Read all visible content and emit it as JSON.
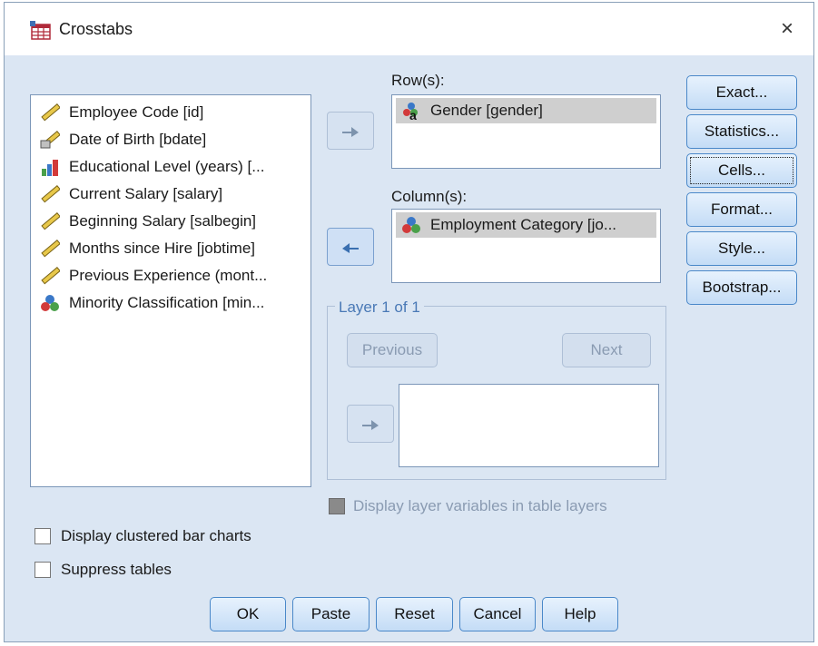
{
  "window": {
    "title": "Crosstabs",
    "close_label": "×"
  },
  "source_variables": [
    {
      "label": "Employee Code [id]",
      "icon": "scale-ruler-icon"
    },
    {
      "label": "Date of Birth [bdate]",
      "icon": "date-ruler-icon"
    },
    {
      "label": "Educational Level (years) [...",
      "icon": "ordinal-bars-icon"
    },
    {
      "label": "Current Salary [salary]",
      "icon": "scale-ruler-icon"
    },
    {
      "label": "Beginning Salary [salbegin]",
      "icon": "scale-ruler-icon"
    },
    {
      "label": "Months since Hire [jobtime]",
      "icon": "scale-ruler-icon"
    },
    {
      "label": "Previous Experience (mont...",
      "icon": "scale-ruler-icon"
    },
    {
      "label": "Minority Classification [min...",
      "icon": "nominal-balls-icon"
    }
  ],
  "rows": {
    "label": "Row(s):",
    "items": [
      {
        "label": "Gender [gender]",
        "icon": "nominal-string-icon"
      }
    ]
  },
  "columns": {
    "label": "Column(s):",
    "items": [
      {
        "label": "Employment Category [jo...",
        "icon": "nominal-balls-icon"
      }
    ]
  },
  "layer": {
    "title": "Layer 1 of 1",
    "previous_label": "Previous",
    "next_label": "Next"
  },
  "right_buttons": {
    "exact": "Exact...",
    "statistics": "Statistics...",
    "cells": "Cells...",
    "format": "Format...",
    "style": "Style...",
    "bootstrap": "Bootstrap..."
  },
  "checkboxes": {
    "display_layer_vars": "Display layer variables in table layers",
    "clustered_bar": "Display clustered bar charts",
    "suppress_tables": "Suppress tables"
  },
  "bottom_buttons": {
    "ok": "OK",
    "paste": "Paste",
    "reset": "Reset",
    "cancel": "Cancel",
    "help": "Help"
  },
  "colors": {
    "dialog_bg": "#dbe6f3",
    "button_border": "#4a88c9",
    "group_title": "#4a79b6"
  }
}
